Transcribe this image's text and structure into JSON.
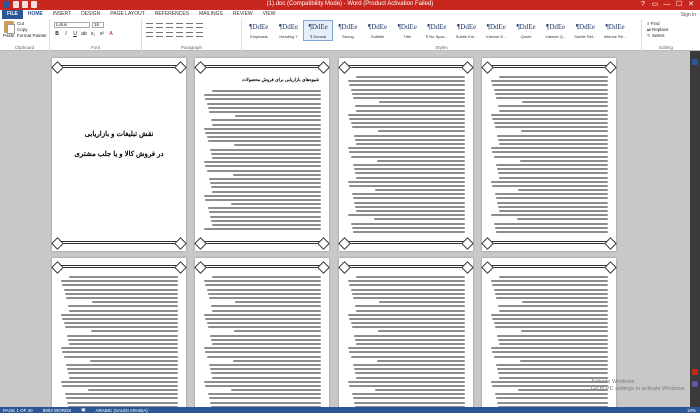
{
  "window": {
    "title": "(1).doc (Compatibility Mode) - Word (Product Activation Failed)",
    "controls": [
      "?",
      "▭",
      "—",
      "☐",
      "✕"
    ]
  },
  "tabs": [
    {
      "label": "FILE"
    },
    {
      "label": "HOME"
    },
    {
      "label": "INSERT"
    },
    {
      "label": "DESIGN"
    },
    {
      "label": "PAGE LAYOUT"
    },
    {
      "label": "REFERENCES"
    },
    {
      "label": "MAILINGS"
    },
    {
      "label": "REVIEW"
    },
    {
      "label": "VIEW"
    }
  ],
  "signin": "Sign in",
  "ribbon": {
    "clipboard": {
      "paste": "Paste",
      "cut": "Cut",
      "copy": "Copy",
      "format_painter": "Format Painter",
      "label": "Clipboard"
    },
    "font": {
      "name": "Lotus",
      "size": "16",
      "label": "Font"
    },
    "paragraph": {
      "label": "Paragraph"
    },
    "styles": {
      "label": "Styles",
      "items": [
        {
          "sample": "¶DdEe",
          "name": "Emphasis"
        },
        {
          "sample": "¶DdEe",
          "name": "Heading 7"
        },
        {
          "sample": "¶DdEe",
          "name": "¶ Normal"
        },
        {
          "sample": "¶DdEe",
          "name": "Strong"
        },
        {
          "sample": "¶DdEe",
          "name": "Subtitle"
        },
        {
          "sample": "¶DdEe",
          "name": "Title"
        },
        {
          "sample": "¶DdEe",
          "name": "¶ No Spac..."
        },
        {
          "sample": "¶DdEe",
          "name": "Subtle Em..."
        },
        {
          "sample": "¶DdEe",
          "name": "Intense E..."
        },
        {
          "sample": "¶DdEe",
          "name": "Quote"
        },
        {
          "sample": "¶DdEe",
          "name": "Intense Q..."
        },
        {
          "sample": "¶DdEe",
          "name": "Subtle Ref..."
        },
        {
          "sample": "¶DdEe",
          "name": "Intense Re..."
        }
      ]
    },
    "editing": {
      "find": "Find",
      "replace": "Replace",
      "select": "Select",
      "label": "Editing"
    }
  },
  "pages": {
    "title_page": {
      "line1": "نقش تبلیغات و بازاریابی",
      "line2": "در فروش کالا و یا جلب مشتری"
    },
    "page2_heading": "شیوه‌های بازاریابی برای فروش محصولات"
  },
  "activation": {
    "line1": "Activate Windows",
    "line2": "Go to PC settings to activate Windows."
  },
  "status": {
    "page": "PAGE 1 OF 40",
    "words": "9903 WORDS",
    "language": "ARABIC (SAUDI ARABIA)",
    "zoom": "10%"
  }
}
